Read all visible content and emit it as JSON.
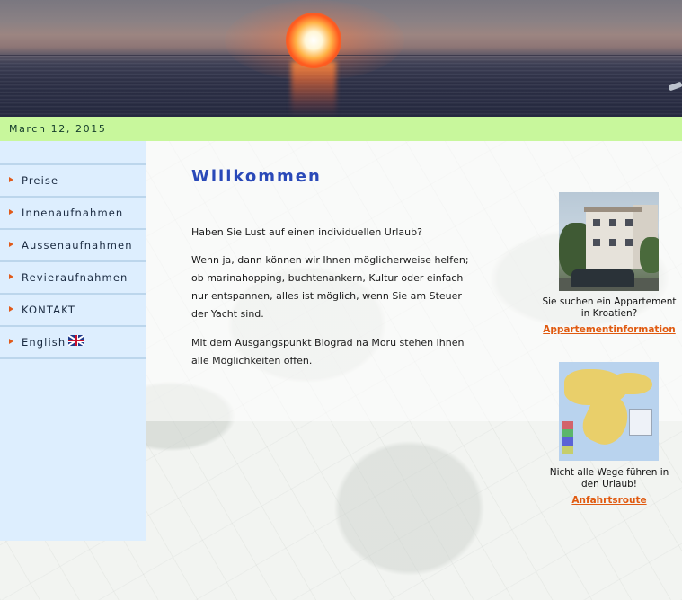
{
  "header": {
    "date": "March 12, 2015"
  },
  "sidebar": {
    "items": [
      {
        "label": "Preise"
      },
      {
        "label": "Innenaufnahmen"
      },
      {
        "label": "Aussenaufnahmen"
      },
      {
        "label": "Revieraufnahmen"
      },
      {
        "label": "KONTAKT"
      },
      {
        "label": "English",
        "icon": "uk-flag-icon"
      }
    ]
  },
  "main": {
    "title": "Willkommen",
    "paragraphs": [
      "Haben Sie Lust auf einen individuellen Urlaub?",
      "Wenn ja, dann können wir Ihnen möglicherweise helfen; ob marinahopping, buchtenankern, Kultur oder einfach nur entspannen, alles ist möglich, wenn Sie am Steuer der Yacht sind.",
      "Mit dem Ausgangspunkt Biograd na Moru stehen Ihnen alle Möglichkeiten offen."
    ]
  },
  "promos": [
    {
      "caption": "Sie suchen ein Appartement in Kroatien?",
      "link": "Appartementinformation"
    },
    {
      "caption": "Nicht alle Wege führen in den Urlaub!",
      "link": "Anfahrtsroute"
    }
  ],
  "colors": {
    "date_bar": "#c8f79c",
    "sidebar": "#ddeefe",
    "title": "#2a49b8",
    "link": "#e05a10",
    "nav_arrow": "#e05a1a"
  }
}
